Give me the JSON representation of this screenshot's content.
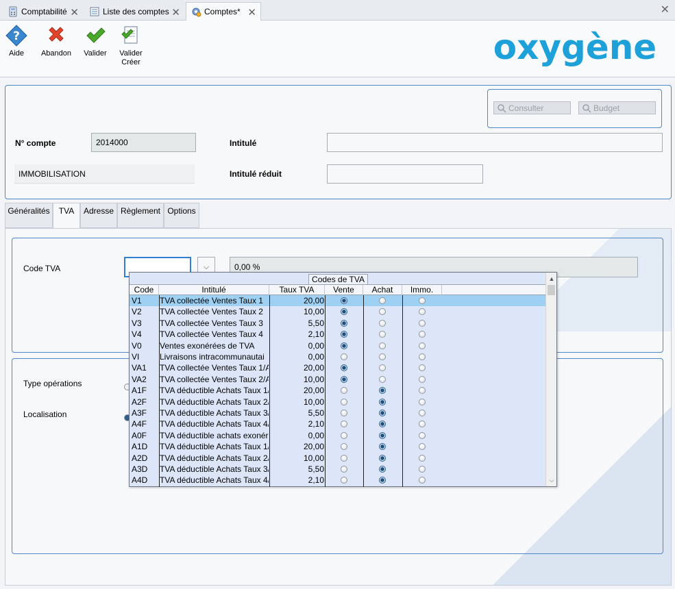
{
  "doc_tabs": [
    {
      "label": "Comptabilité"
    },
    {
      "label": "Liste des comptes"
    },
    {
      "label": "Comptes*"
    }
  ],
  "toolbar": {
    "help_label": "Aide",
    "abandon_label": "Abandon",
    "validate_label": "Valider",
    "validate_create_line1": "Valider",
    "validate_create_line2": "Créer",
    "logo_text": "oxygène"
  },
  "header": {
    "consult_label": "Consulter",
    "budget_label": "Budget",
    "account_no_label": "N° compte",
    "account_no_value": "2014000",
    "intitule_label": "Intitulé",
    "intitule_value": "",
    "category_value": "IMMOBILISATION",
    "intitule_reduit_label": "Intitulé réduit",
    "intitule_reduit_value": ""
  },
  "section_tabs": [
    {
      "label": "Généralités"
    },
    {
      "label": "TVA"
    },
    {
      "label": "Adresse"
    },
    {
      "label": "Règlement"
    },
    {
      "label": "Options"
    }
  ],
  "tva": {
    "code_tva_label": "Code TVA",
    "code_tva_value": "",
    "rate_value": "0,00 %",
    "type_operations_label": "Type opérations",
    "localisation_label": "Localisation"
  },
  "dropdown": {
    "title": "Codes de TVA",
    "columns": [
      "Code",
      "Intitulé",
      "Taux TVA",
      "Vente",
      "Achat",
      "Immo."
    ],
    "rows": [
      {
        "code": "V1",
        "intitule": "TVA collectée Ventes Taux 1",
        "taux": "20,00",
        "type": "vente"
      },
      {
        "code": "V2",
        "intitule": "TVA collectée Ventes Taux 2",
        "taux": "10,00",
        "type": "vente"
      },
      {
        "code": "V3",
        "intitule": "TVA collectée Ventes Taux 3",
        "taux": "5,50",
        "type": "vente"
      },
      {
        "code": "V4",
        "intitule": "TVA collectée Ventes Taux 4",
        "taux": "2,10",
        "type": "vente"
      },
      {
        "code": "V0",
        "intitule": "Ventes exonérées de TVA",
        "taux": "0,00",
        "type": "vente"
      },
      {
        "code": "VI",
        "intitule": "Livraisons intracommunautai",
        "taux": "0,00",
        "type": "none"
      },
      {
        "code": "VA1",
        "intitule": "TVA collectée Ventes Taux 1/A",
        "taux": "20,00",
        "type": "vente"
      },
      {
        "code": "VA2",
        "intitule": "TVA collectée Ventes Taux 2/A",
        "taux": "10,00",
        "type": "vente"
      },
      {
        "code": "A1F",
        "intitule": "TVA déductible Achats Taux 1/",
        "taux": "20,00",
        "type": "achat"
      },
      {
        "code": "A2F",
        "intitule": "TVA déductible Achats Taux 2/",
        "taux": "10,00",
        "type": "achat"
      },
      {
        "code": "A3F",
        "intitule": "TVA déductible Achats Taux 3/",
        "taux": "5,50",
        "type": "achat"
      },
      {
        "code": "A4F",
        "intitule": "TVA déductible Achats Taux 4/",
        "taux": "2,10",
        "type": "achat"
      },
      {
        "code": "A0F",
        "intitule": "TVA déductible achats exonér",
        "taux": "0,00",
        "type": "achat"
      },
      {
        "code": "A1D",
        "intitule": "TVA déductible Achats Taux 1/",
        "taux": "20,00",
        "type": "achat"
      },
      {
        "code": "A2D",
        "intitule": "TVA déductible Achats Taux 2/",
        "taux": "10,00",
        "type": "achat"
      },
      {
        "code": "A3D",
        "intitule": "TVA déductible Achats Taux 3/",
        "taux": "5,50",
        "type": "achat"
      },
      {
        "code": "A4D",
        "intitule": "TVA déductible Achats Taux 4/",
        "taux": "2,10",
        "type": "achat"
      }
    ],
    "selected_index": 0
  },
  "colors": {
    "accent_blue": "#4f86c6",
    "selection": "#9dd0f3",
    "logo_blue": "#1ea0d8",
    "abandon_red": "#e0442c",
    "validate_green": "#4aa82a"
  }
}
